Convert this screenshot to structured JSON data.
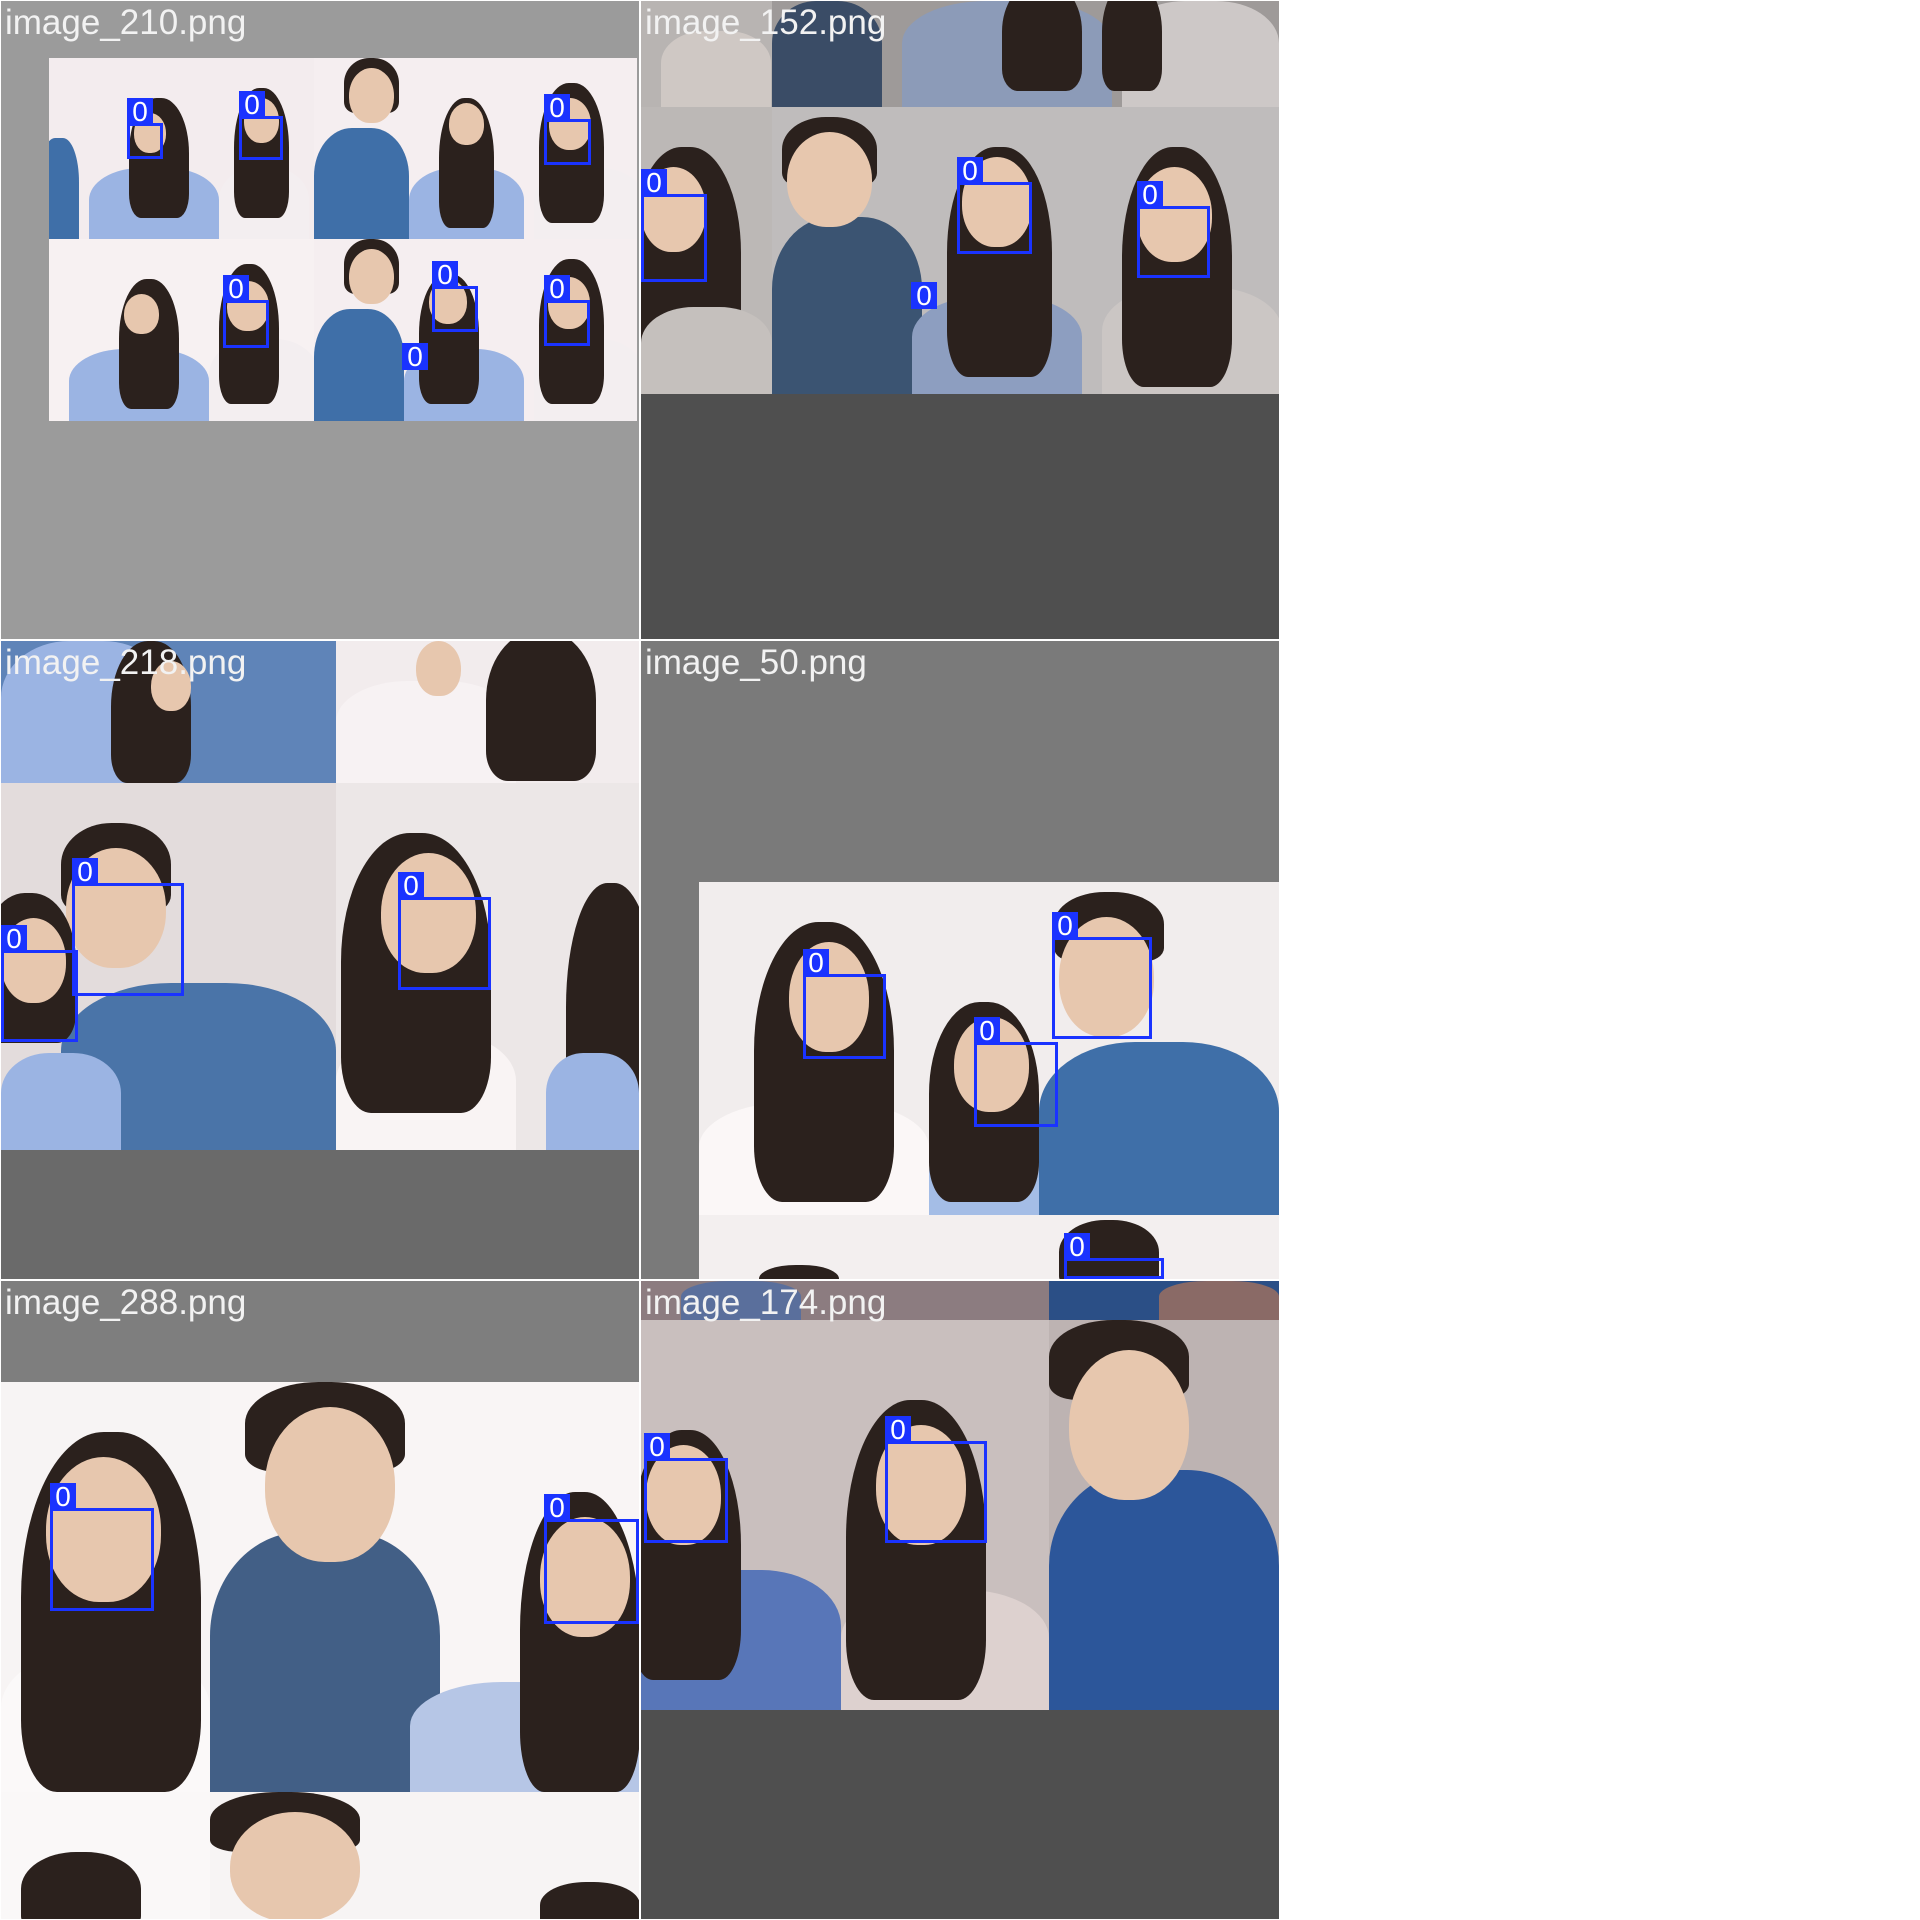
{
  "tiles": [
    {
      "filename": "image_210.png"
    },
    {
      "filename": "image_152.png"
    },
    {
      "filename": "image_218.png"
    },
    {
      "filename": "image_50.png"
    },
    {
      "filename": "image_288.png"
    },
    {
      "filename": "image_174.png"
    }
  ],
  "class_label": "0",
  "colors": {
    "bbox": "#1a33ff",
    "tile_bg_light": "#9b9b9b",
    "tile_bg_mid": "#7a7a7a",
    "tile_bg_dark": "#4f4f4f"
  }
}
